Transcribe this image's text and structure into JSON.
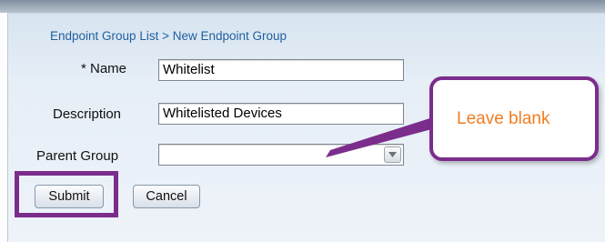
{
  "breadcrumb": "Endpoint Group List > New Endpoint Group",
  "form": {
    "name_label": "* Name",
    "name_value": "Whitelist",
    "description_label": "Description",
    "description_value": "Whitelisted Devices",
    "parent_label": "Parent Group",
    "parent_value": ""
  },
  "buttons": {
    "submit": "Submit",
    "cancel": "Cancel"
  },
  "annotation": {
    "callout_text": "Leave blank",
    "color": "#7b2d8c",
    "text_color": "#f07d22"
  }
}
